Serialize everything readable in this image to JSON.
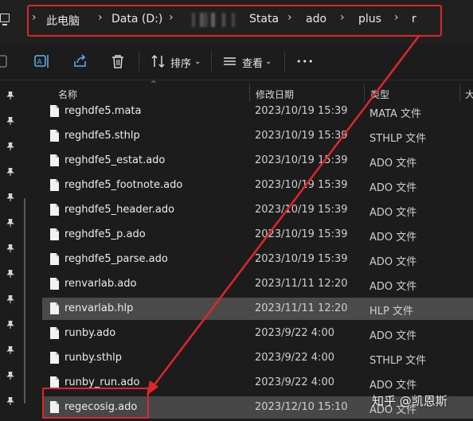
{
  "address_bar": {
    "crumbs": [
      "此电脑",
      "Data (D:)",
      "Stata",
      "ado",
      "plus",
      "r"
    ],
    "separator": "›",
    "highlight_color": "#e0262b"
  },
  "toolbar": {
    "sort_label": "排序",
    "view_label": "查看",
    "more_label": "•••",
    "icons": [
      "rename-icon",
      "share-icon",
      "delete-icon",
      "sort-icon",
      "view-icon",
      "more-icon"
    ]
  },
  "columns": {
    "name": "名称",
    "date": "修改日期",
    "type": "类型",
    "size": "大"
  },
  "files": [
    {
      "name": "reghdfe5.mata",
      "date": "2023/10/19 15:39",
      "type": "MATA 文件"
    },
    {
      "name": "reghdfe5.sthlp",
      "date": "2023/10/19 15:39",
      "type": "STHLP 文件"
    },
    {
      "name": "reghdfe5_estat.ado",
      "date": "2023/10/19 15:39",
      "type": "ADO 文件"
    },
    {
      "name": "reghdfe5_footnote.ado",
      "date": "2023/10/19 15:39",
      "type": "ADO 文件"
    },
    {
      "name": "reghdfe5_header.ado",
      "date": "2023/10/19 15:39",
      "type": "ADO 文件"
    },
    {
      "name": "reghdfe5_p.ado",
      "date": "2023/10/19 15:39",
      "type": "ADO 文件"
    },
    {
      "name": "reghdfe5_parse.ado",
      "date": "2023/10/19 15:39",
      "type": "ADO 文件"
    },
    {
      "name": "renvarlab.ado",
      "date": "2023/11/11 12:20",
      "type": "ADO 文件"
    },
    {
      "name": "renvarlab.hlp",
      "date": "2023/11/11 12:20",
      "type": "HLP 文件"
    },
    {
      "name": "runby.ado",
      "date": "2023/9/22 4:00",
      "type": "ADO 文件"
    },
    {
      "name": "runby.sthlp",
      "date": "2023/9/22 4:00",
      "type": "STHLP 文件"
    },
    {
      "name": "runby_run.ado",
      "date": "2023/9/22 4:00",
      "type": "ADO 文件"
    },
    {
      "name": "regecosig.ado",
      "date": "2023/12/10 15:10",
      "type": "ADO 文件"
    }
  ],
  "watermark": "知乎 @凯恩斯"
}
